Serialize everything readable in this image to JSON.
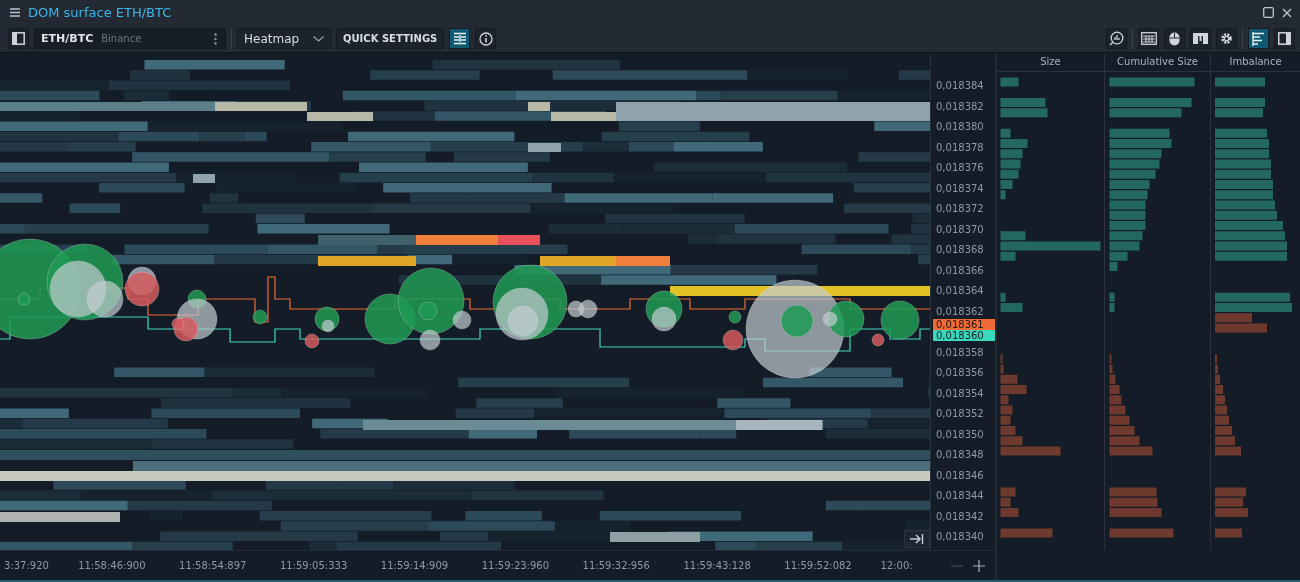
{
  "window": {
    "title": "DOM surface ETH/BTC"
  },
  "toolbar": {
    "sidebar_toggle": {
      "on": false
    },
    "instrument": {
      "symbol": "ETH/BTC",
      "exchange": "Binance"
    },
    "mode": {
      "value": "Heatmap"
    },
    "quick_settings": {
      "label": "QUICK SETTINGS"
    },
    "filter_toggle": {
      "on": true
    },
    "right_tools": [
      {
        "kind": "chart-search",
        "on": false
      },
      {
        "kind": "keyboard",
        "on": false
      },
      {
        "kind": "mouse",
        "on": false
      },
      {
        "kind": "template",
        "on": false
      },
      {
        "kind": "settings",
        "on": false
      },
      {
        "kind": "dom-panel",
        "on": true
      },
      {
        "kind": "side-panel",
        "on": false
      }
    ]
  },
  "price_axis": {
    "labels": [
      "0,018384",
      "0,018382",
      "0,018380",
      "0,018378",
      "0,018376",
      "0,018374",
      "0,018372",
      "0,018370",
      "0,018368",
      "0,018366",
      "0,018364",
      "0,018362",
      "0,018358",
      "0,018356",
      "0,018354",
      "0,018352",
      "0,018350",
      "0,018348",
      "0,018346",
      "0,018344",
      "0,018342",
      "0,018340"
    ],
    "markers": [
      {
        "text": "0,018361",
        "color": "#f06a35"
      },
      {
        "text": "0,018360",
        "color": "#3ad9bf"
      }
    ]
  },
  "time_axis": {
    "labels": [
      "3:37:920",
      "11:58:46:900",
      "11:58:54:897",
      "11:59:05:333",
      "11:59:14:909",
      "11:59:23:960",
      "11:59:32:956",
      "11:59:43:128",
      "11:59:52:082",
      "12:00:"
    ]
  },
  "dom_panel": {
    "columns": [
      "Size",
      "Cumulative Size",
      "Imbalance"
    ]
  }
}
